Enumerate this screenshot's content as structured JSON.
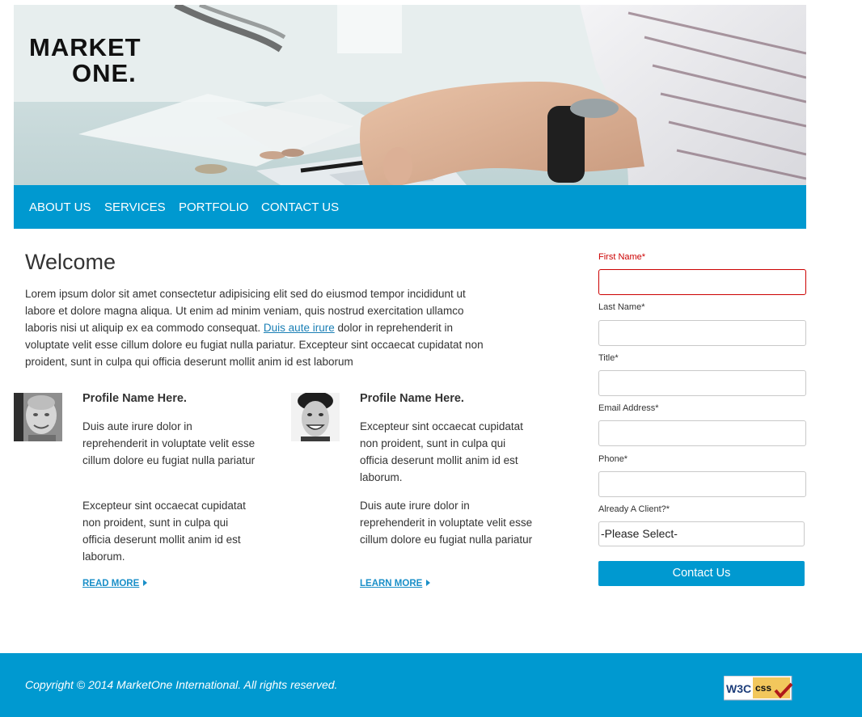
{
  "brand": {
    "logo_line1": "MARKET",
    "logo_line2": "ONE."
  },
  "nav": {
    "items": [
      "ABOUT US",
      "SERVICES",
      "PORTFOLIO",
      "CONTACT US"
    ]
  },
  "main": {
    "title": "Welcome",
    "intro_before_link": "Lorem ipsum dolor sit amet consectetur adipisicing elit sed do eiusmod tempor incididunt ut labore et dolore magna aliqua. Ut enim ad minim veniam, quis nostrud exercitation ullamco laboris nisi ut aliquip ex ea commodo consequat. ",
    "intro_link": "Duis aute irure",
    "intro_after_link": " dolor in reprehenderit in voluptate velit esse cillum dolore eu fugiat nulla pariatur. Excepteur sint occaecat cupidatat non proident, sunt in culpa qui officia deserunt mollit anim id est laborum"
  },
  "profiles": [
    {
      "name": "Profile Name Here.",
      "para1": "Duis aute irure dolor in reprehenderit in voluptate velit esse cillum dolore eu fugiat nulla pariatur",
      "para2": "Excepteur sint occaecat cupidatat non proident, sunt in culpa qui officia deserunt mollit anim id est laborum.",
      "link": "READ MORE"
    },
    {
      "name": "Profile Name Here.",
      "para1": "Excepteur sint occaecat cupidatat non proident, sunt in culpa qui officia deserunt mollit anim id est laborum.",
      "para2": "Duis aute irure dolor in reprehenderit in voluptate velit esse cillum dolore eu fugiat nulla pariatur",
      "link": "LEARN MORE"
    }
  ],
  "form": {
    "first_name_label": "First Name*",
    "last_name_label": "Last Name*",
    "title_label": "Title*",
    "email_label": "Email Address*",
    "phone_label": "Phone*",
    "client_label": "Already A Client?*",
    "client_selected": "-Please Select-",
    "submit_label": "Contact Us"
  },
  "footer": {
    "copyright": "Copyright © 2014 MarketOne International. All rights reserved."
  },
  "colors": {
    "accent": "#0099d0",
    "error": "#cc0000",
    "link": "#1a7fb5"
  }
}
